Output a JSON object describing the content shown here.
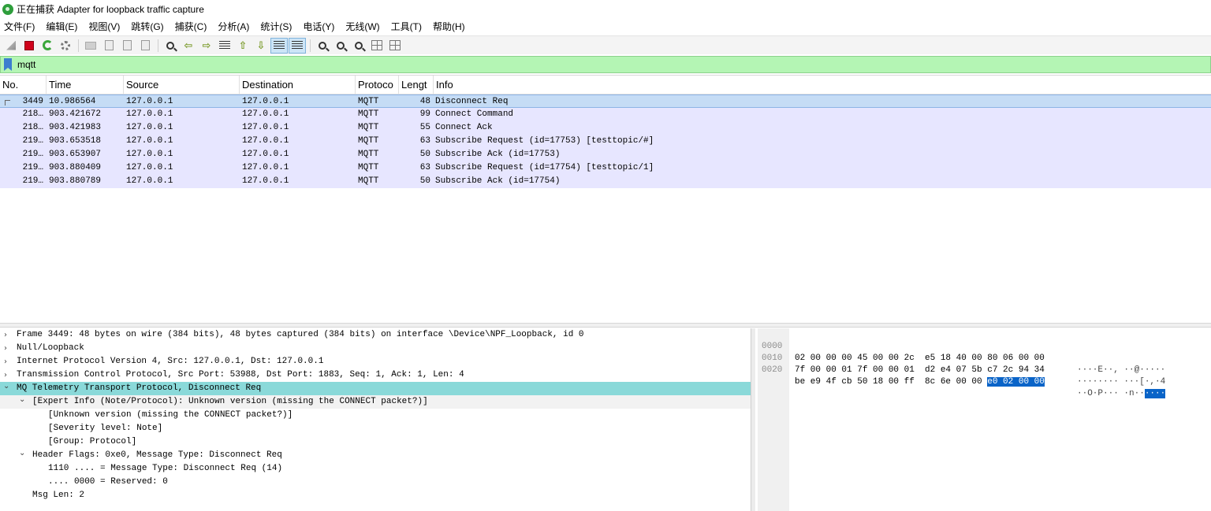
{
  "window": {
    "title": "正在捕获 Adapter for loopback traffic capture"
  },
  "menu": [
    "文件(F)",
    "编辑(E)",
    "视图(V)",
    "跳转(G)",
    "捕获(C)",
    "分析(A)",
    "统计(S)",
    "电话(Y)",
    "无线(W)",
    "工具(T)",
    "帮助(H)"
  ],
  "toolbar": {
    "icons": [
      "shark-fin-icon",
      "stop-capture-icon",
      "restart-capture-icon",
      "capture-options-icon",
      "open-file-icon",
      "save-file-icon",
      "close-file-icon",
      "reload-file-icon",
      "find-packet-icon",
      "go-back-icon",
      "go-forward-icon",
      "go-to-packet-icon",
      "first-packet-icon",
      "last-packet-icon",
      "autoscroll-icon",
      "colorize-icon",
      "zoom-in-icon",
      "zoom-out-icon",
      "normal-size-icon",
      "resize-columns-icon",
      "layout-icon"
    ]
  },
  "filter": {
    "value": "mqtt",
    "bar_color": "#b4f5b4"
  },
  "packet_list": {
    "columns": [
      "No.",
      "Time",
      "Source",
      "Destination",
      "Protoco",
      "Lengt",
      "Info"
    ],
    "rows": [
      {
        "no": "3449",
        "time": "10.986564",
        "source": "127.0.0.1",
        "destination": "127.0.0.1",
        "protocol": "MQTT",
        "length": "48",
        "info": "Disconnect Req",
        "selected": true
      },
      {
        "no": "218…",
        "time": "903.421672",
        "source": "127.0.0.1",
        "destination": "127.0.0.1",
        "protocol": "MQTT",
        "length": "99",
        "info": "Connect Command"
      },
      {
        "no": "218…",
        "time": "903.421983",
        "source": "127.0.0.1",
        "destination": "127.0.0.1",
        "protocol": "MQTT",
        "length": "55",
        "info": "Connect Ack"
      },
      {
        "no": "219…",
        "time": "903.653518",
        "source": "127.0.0.1",
        "destination": "127.0.0.1",
        "protocol": "MQTT",
        "length": "63",
        "info": "Subscribe Request (id=17753) [testtopic/#]"
      },
      {
        "no": "219…",
        "time": "903.653907",
        "source": "127.0.0.1",
        "destination": "127.0.0.1",
        "protocol": "MQTT",
        "length": "50",
        "info": "Subscribe Ack (id=17753)"
      },
      {
        "no": "219…",
        "time": "903.880409",
        "source": "127.0.0.1",
        "destination": "127.0.0.1",
        "protocol": "MQTT",
        "length": "63",
        "info": "Subscribe Request (id=17754) [testtopic/1]"
      },
      {
        "no": "219…",
        "time": "903.880789",
        "source": "127.0.0.1",
        "destination": "127.0.0.1",
        "protocol": "MQTT",
        "length": "50",
        "info": "Subscribe Ack (id=17754)"
      }
    ],
    "row_color": "#e7e6ff",
    "selected_color": "#c5dcf5"
  },
  "details": {
    "rows": [
      {
        "text": "Frame 3449: 48 bytes on wire (384 bits), 48 bytes captured (384 bits) on interface \\Device\\NPF_Loopback, id 0",
        "caret": "›"
      },
      {
        "text": "Null/Loopback",
        "caret": "›"
      },
      {
        "text": "Internet Protocol Version 4, Src: 127.0.0.1, Dst: 127.0.0.1",
        "caret": "›"
      },
      {
        "text": "Transmission Control Protocol, Src Port: 53988, Dst Port: 1883, Seq: 1, Ack: 1, Len: 4",
        "caret": "›"
      },
      {
        "text": "MQ Telemetry Transport Protocol, Disconnect Req",
        "caret": "⌄"
      },
      {
        "text": "[Expert Info (Note/Protocol): Unknown version (missing the CONNECT packet?)]",
        "caret": "⌄"
      },
      {
        "text": "[Unknown version (missing the CONNECT packet?)]",
        "caret": ""
      },
      {
        "text": "[Severity level: Note]",
        "caret": ""
      },
      {
        "text": "[Group: Protocol]",
        "caret": ""
      },
      {
        "text": "Header Flags: 0xe0, Message Type: Disconnect Req",
        "caret": "⌄"
      },
      {
        "text": "1110 .... = Message Type: Disconnect Req (14)",
        "caret": ""
      },
      {
        "text": ".... 0000 = Reserved: 0",
        "caret": ""
      },
      {
        "text": "Msg Len: 2",
        "caret": ""
      }
    ],
    "highlight_color": "#8ad9d9"
  },
  "hex": {
    "rows": [
      {
        "offset": "0000",
        "bytes": "02 00 00 00 45 00 00 2c  e5 18 40 00 80 06 00 00",
        "bytes_hl": "",
        "ascii": "····E··, ··@·····",
        "ascii_hl": ""
      },
      {
        "offset": "0010",
        "bytes": "7f 00 00 01 7f 00 00 01  d2 e4 07 5b c7 2c 94 34",
        "bytes_hl": "",
        "ascii": "········ ···[·,·4",
        "ascii_hl": ""
      },
      {
        "offset": "0020",
        "bytes": "be e9 4f cb 50 18 00 ff  8c 6e 00 00 ",
        "bytes_hl": "e0 02 00 00",
        "ascii": "··O·P··· ·n··",
        "ascii_hl": "····"
      }
    ],
    "highlight_color": "#0a64c8"
  }
}
